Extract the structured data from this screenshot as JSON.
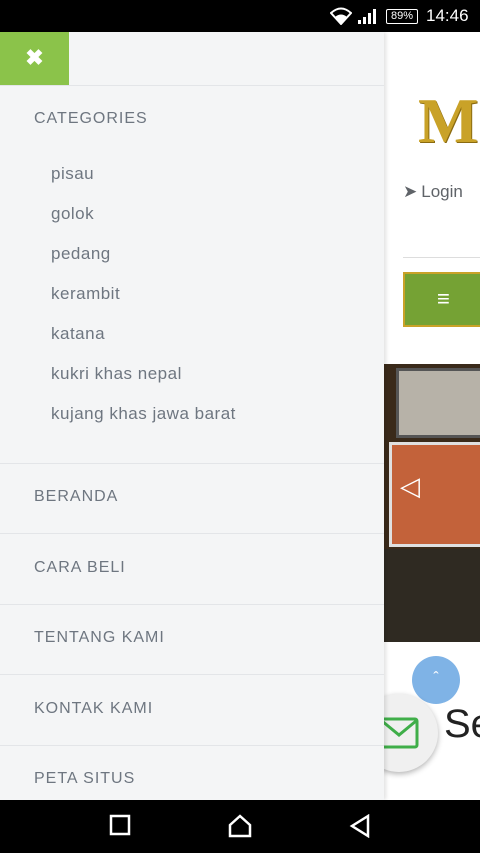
{
  "status_bar": {
    "battery": "89%",
    "time": "14:46"
  },
  "page": {
    "logo_partial": "M",
    "login_label": "Login",
    "section_heading_partial": "Se"
  },
  "drawer": {
    "categories_heading": "CATEGORIES",
    "categories": [
      "pisau",
      "golok",
      "pedang",
      "kerambit",
      "katana",
      "kukri khas nepal",
      "kujang khas jawa barat"
    ],
    "menu": [
      "BERANDA",
      "CARA BELI",
      "TENTANG KAMI",
      "KONTAK KAMI",
      "PETA SITUS"
    ]
  }
}
